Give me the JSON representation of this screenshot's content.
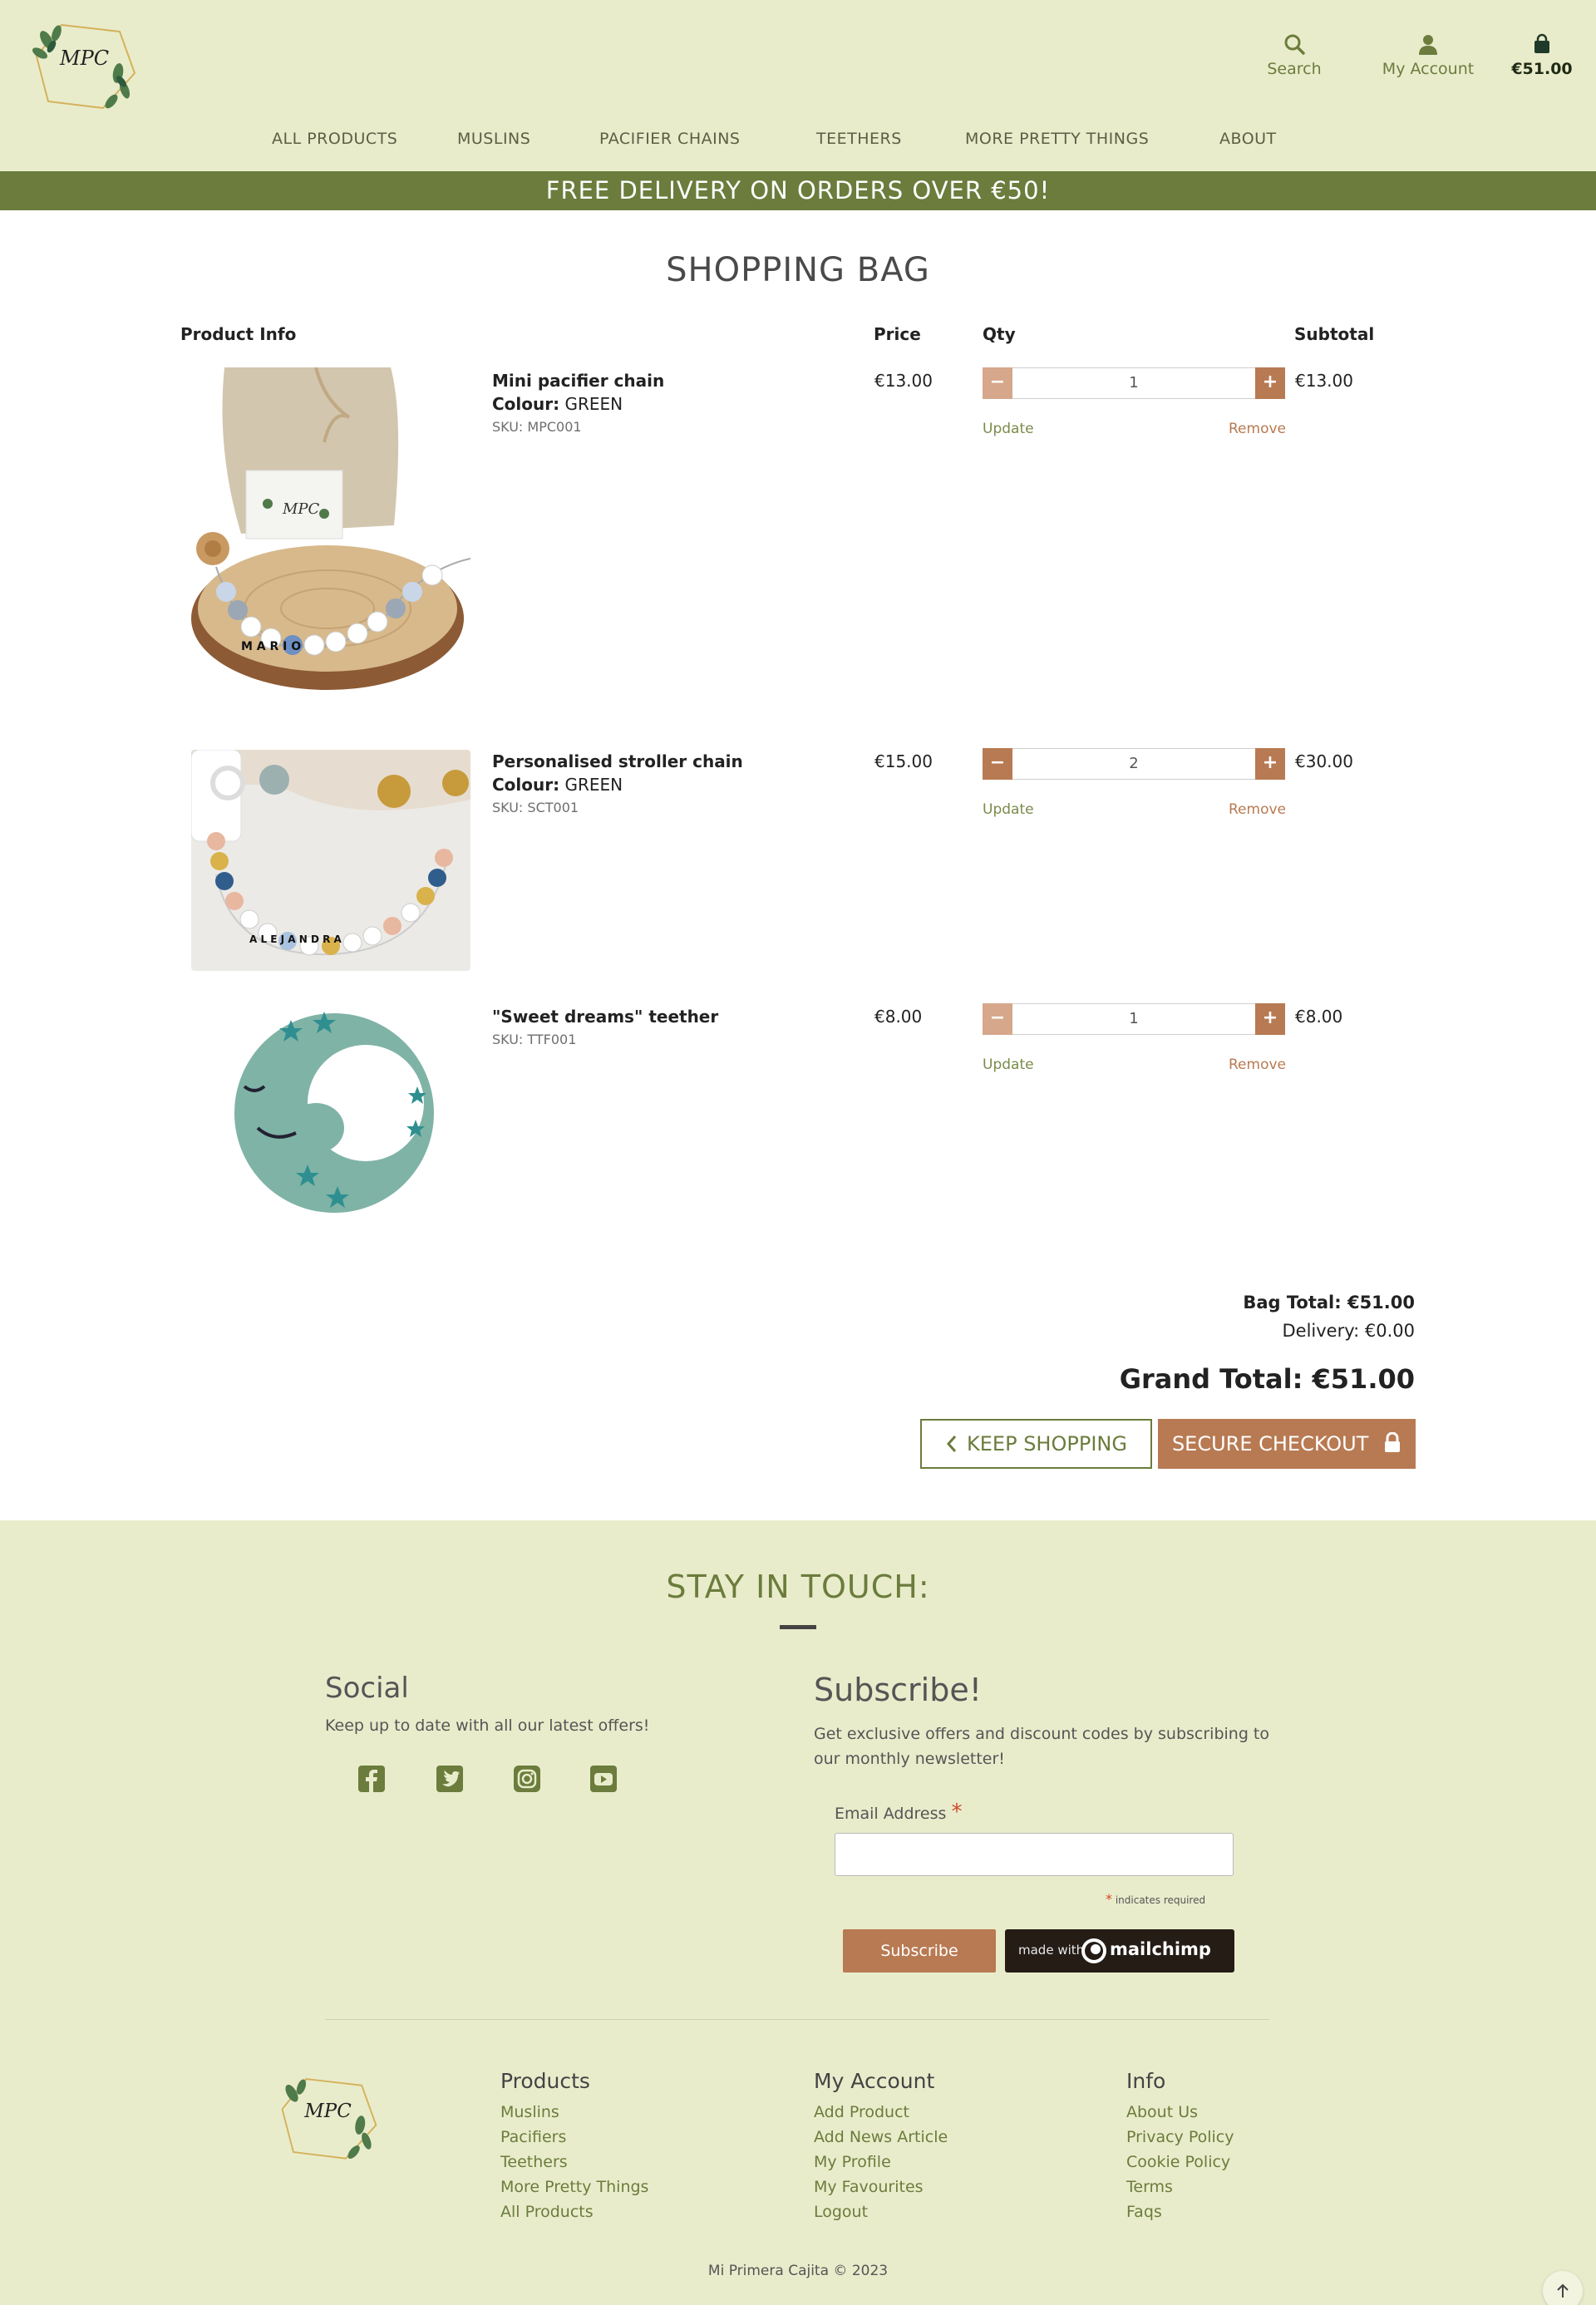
{
  "header": {
    "logo_text": "MPC",
    "search_label": "Search",
    "account_label": "My Account",
    "cart_total": "€51.00"
  },
  "nav": [
    "ALL PRODUCTS",
    "MUSLINS",
    "PACIFIER CHAINS",
    "TEETHERS",
    "MORE PRETTY THINGS",
    "ABOUT"
  ],
  "banner": "FREE DELIVERY ON ORDERS OVER €50!",
  "bag": {
    "title": "SHOPPING BAG",
    "columns": {
      "product_info": "Product Info",
      "price": "Price",
      "qty": "Qty",
      "subtotal": "Subtotal"
    },
    "update_label": "Update",
    "remove_label": "Remove",
    "colour_label": "Colour:",
    "items": [
      {
        "name": "Mini pacifier chain",
        "colour": "GREEN",
        "sku": "SKU: MPC001",
        "price": "€13.00",
        "qty": "1",
        "subtotal": "€13.00",
        "image_letters": "M A R I O"
      },
      {
        "name": "Personalised stroller chain",
        "colour": "GREEN",
        "sku": "SKU: SCT001",
        "price": "€15.00",
        "qty": "2",
        "subtotal": "€30.00",
        "image_letters": "A L E J A N D R A"
      },
      {
        "name": "\"Sweet dreams\" teether",
        "colour": "",
        "sku": "SKU: TTF001",
        "price": "€8.00",
        "qty": "1",
        "subtotal": "€8.00",
        "image_letters": ""
      }
    ],
    "bag_total": "Bag Total: €51.00",
    "delivery": "Delivery: €0.00",
    "grand_total": "Grand Total: €51.00",
    "keep_shopping": "KEEP SHOPPING",
    "secure_checkout": "SECURE CHECKOUT"
  },
  "footer": {
    "stay_title": "STAY IN TOUCH:",
    "social_title": "Social",
    "social_text": "Keep up to date with all our latest offers!",
    "social_icons": [
      "facebook-icon",
      "twitter-icon",
      "instagram-icon",
      "youtube-icon"
    ],
    "subscribe_title": "Subscribe!",
    "subscribe_text": "Get exclusive offers and discount codes by subscribing to our monthly newsletter!",
    "email_label": "Email Address",
    "required_note": "indicates required",
    "subscribe_button": "Subscribe",
    "mailchimp_made": "made with",
    "mailchimp_name": "mailchimp",
    "columns": [
      {
        "title": "Products",
        "links": [
          "Muslins",
          "Pacifiers",
          "Teethers",
          "More Pretty Things",
          "All Products"
        ]
      },
      {
        "title": "My Account",
        "links": [
          "Add Product",
          "Add News Article",
          "My Profile",
          "My Favourites",
          "Logout"
        ]
      },
      {
        "title": "Info",
        "links": [
          "About Us",
          "Privacy Policy",
          "Cookie Policy",
          "Terms",
          "Faqs"
        ]
      }
    ],
    "copyright": "Mi Primera Cajita © 2023"
  },
  "colors": {
    "header_bg": "#e9eccb",
    "olive": "#6b7c3c",
    "terracotta": "#b87a52"
  }
}
